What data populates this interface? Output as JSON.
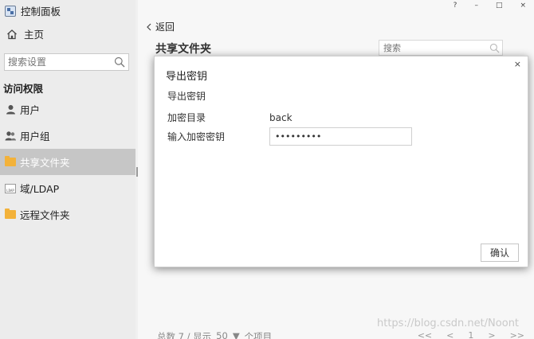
{
  "app": {
    "title": "控制面板"
  },
  "sidebar": {
    "home_label": "主页",
    "search_placeholder": "搜索设置",
    "section_title": "访问权限",
    "items": [
      {
        "label": "用户",
        "icon": "user-icon"
      },
      {
        "label": "用户组",
        "icon": "user-group-icon"
      },
      {
        "label": "共享文件夹",
        "icon": "shared-folder-icon",
        "active": true
      },
      {
        "label": "域/LDAP",
        "icon": "ldap-icon"
      },
      {
        "label": "远程文件夹",
        "icon": "remote-folder-icon"
      }
    ]
  },
  "window_controls": {
    "help": "?",
    "minimize": "–",
    "maximize": "□",
    "close": "×"
  },
  "main": {
    "back_label": "返回",
    "title": "共享文件夹",
    "search_placeholder": "搜索",
    "footer": {
      "total": "总数 7 / 显示",
      "per_page": "50",
      "items_label": "个项目"
    },
    "pager": {
      "first": "<<",
      "prev": "<",
      "page": "1",
      "next": ">",
      "last": ">>"
    },
    "watermark": "https://blog.csdn.net/Noont"
  },
  "modal": {
    "title": "导出密钥",
    "subtitle": "导出密钥",
    "rows": [
      {
        "label": "加密目录",
        "value": "back"
      },
      {
        "label": "输入加密密钥",
        "value": "•••••••••"
      }
    ],
    "confirm_label": "确认",
    "close": "×"
  },
  "colors": {
    "active_nav_bg": "#c6c6c6",
    "folder": "#f3b23a",
    "sidebar_bg": "#ececec"
  }
}
